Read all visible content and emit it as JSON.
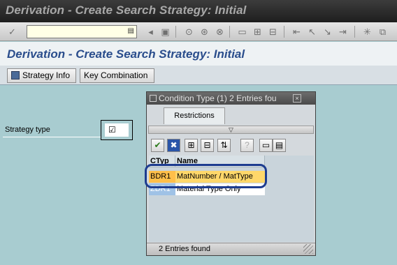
{
  "window": {
    "title": "Derivation - Create Search Strategy: Initial"
  },
  "std_toolbar": {
    "command_field": {
      "value": "",
      "placeholder": ""
    },
    "icons": [
      "enter-icon",
      "back-icon",
      "save-icon",
      "exit-icon",
      "cancel-icon",
      "print-icon",
      "find-icon",
      "find-next-icon",
      "first-page-icon",
      "previous-page-icon",
      "next-page-icon",
      "last-page-icon",
      "new-session-icon",
      "shortcut-icon"
    ]
  },
  "screen": {
    "title": "Derivation - Create Search Strategy: Initial",
    "buttons": {
      "strategy_info": "Strategy Info",
      "key_combination": "Key Combination"
    },
    "strategy_type": {
      "label": "Strategy type",
      "value": ""
    }
  },
  "popup": {
    "title": "Condition Type (1)   2 Entries fou",
    "tab_restrictions": "Restrictions",
    "columns": {
      "ctyp": "CTyp",
      "name": "Name"
    },
    "rows": [
      {
        "ctyp": "BDR1",
        "name": "MatNumber / MatType"
      },
      {
        "ctyp": "ZDR1",
        "name": "Material Type Only"
      }
    ],
    "status": "2 Entries found"
  }
}
